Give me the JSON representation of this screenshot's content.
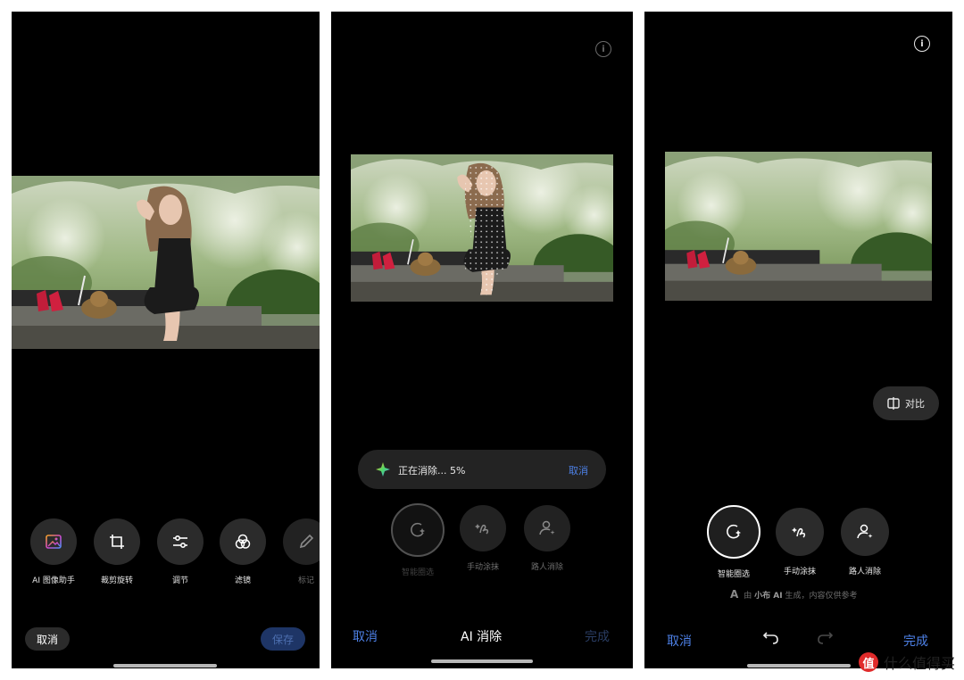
{
  "colors": {
    "accent": "#4d80e6",
    "panel_bg": "#000000",
    "button_bg": "#2b2b2b"
  },
  "panel1": {
    "tools": [
      {
        "label": "AI 图像助手",
        "icon": "ai-image-icon"
      },
      {
        "label": "裁剪旋转",
        "icon": "crop-rotate-icon"
      },
      {
        "label": "调节",
        "icon": "sliders-icon"
      },
      {
        "label": "滤镜",
        "icon": "filter-icon"
      },
      {
        "label": "标记",
        "icon": "markup-pen-icon"
      }
    ],
    "cancel": "取消",
    "save": "保存"
  },
  "panel2": {
    "progress_text": "正在消除... 5%",
    "progress_cancel": "取消",
    "tools": [
      {
        "label": "智能圈选",
        "icon": "smart-lasso-icon"
      },
      {
        "label": "手动涂抹",
        "icon": "brush-icon"
      },
      {
        "label": "路人消除",
        "icon": "person-remove-icon"
      }
    ],
    "cancel": "取消",
    "title": "AI 消除",
    "done": "完成"
  },
  "panel3": {
    "compare": "对比",
    "tools": [
      {
        "label": "智能圈选",
        "icon": "smart-lasso-icon"
      },
      {
        "label": "手动涂抹",
        "icon": "brush-icon"
      },
      {
        "label": "路人消除",
        "icon": "person-remove-icon"
      }
    ],
    "ai_note_prefix": "由 ",
    "ai_note_brand": "小布 AI",
    "ai_note_suffix": " 生成，内容仅供参考",
    "cancel": "取消",
    "done": "完成"
  },
  "watermark": {
    "logo": "值",
    "text": "什么值得买"
  }
}
